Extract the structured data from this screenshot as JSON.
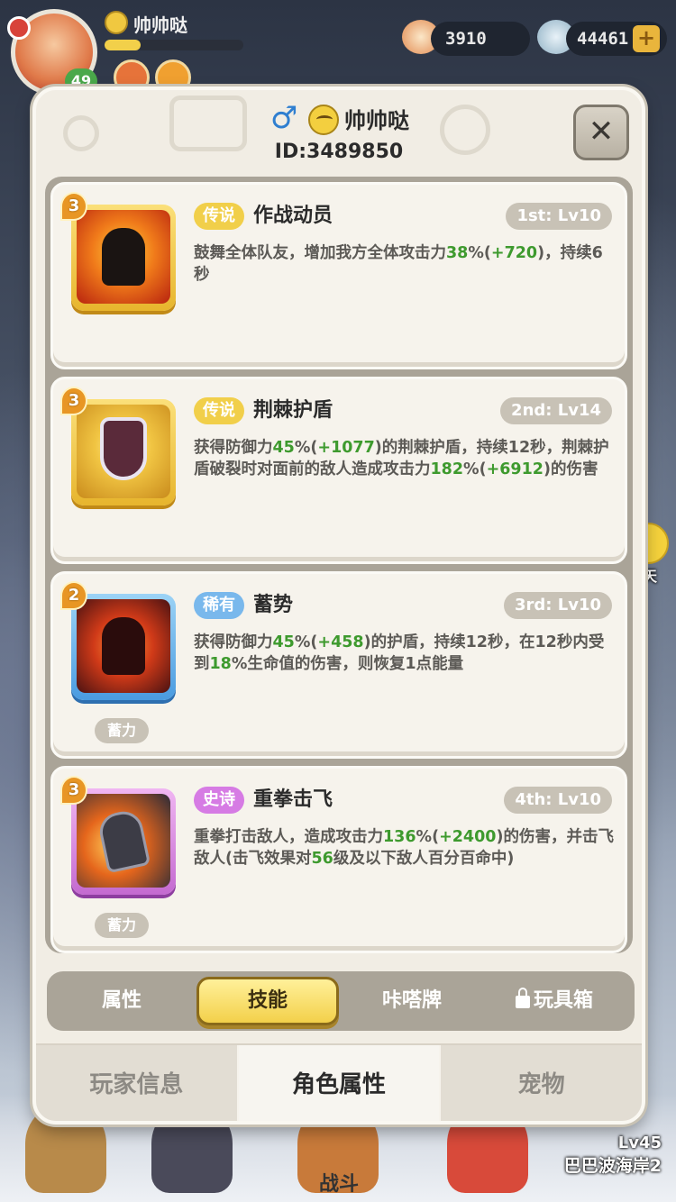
{
  "hud": {
    "player_name": "帅帅哒",
    "avatar_level": "49",
    "shells": "3910",
    "gems": "44461",
    "plus": "+"
  },
  "background": {
    "battle_label": "战斗",
    "lock_level": "Lv45",
    "area_name": "巴巴波海岸2",
    "chat_label": "聊天"
  },
  "modal": {
    "gender_symbol": "♂",
    "player_name": "帅帅哒",
    "player_id": "ID:3489850",
    "close_label": "✕"
  },
  "skills": [
    {
      "stars": "3",
      "rarity": "传说",
      "name": "作战动员",
      "slot": "1st: Lv10",
      "desc_parts": [
        "鼓舞全体队友，增加我方全体攻击力",
        "38",
        "%(",
        "+720",
        ")，持续6秒"
      ],
      "charge": ""
    },
    {
      "stars": "3",
      "rarity": "传说",
      "name": "荆棘护盾",
      "slot": "2nd: Lv14",
      "desc_parts": [
        "获得防御力",
        "45",
        "%(",
        "+1077",
        ")的荆棘护盾，持续12秒，荆棘护盾破裂时对面前的敌人造成攻击力",
        "182",
        "%(",
        "+6912",
        ")的伤害"
      ],
      "charge": ""
    },
    {
      "stars": "2",
      "rarity": "稀有",
      "name": "蓄势",
      "slot": "3rd: Lv10",
      "desc_parts": [
        "获得防御力",
        "45",
        "%(",
        "+458",
        ")的护盾，持续12秒，在12秒内受到",
        "18",
        "%生命值的伤害，则恢复1点能量"
      ],
      "charge": "蓄力"
    },
    {
      "stars": "3",
      "rarity": "史诗",
      "name": "重拳击飞",
      "slot": "4th: Lv10",
      "desc_parts": [
        "重拳打击敌人，造成攻击力",
        "136",
        "%(",
        "+2400",
        ")的伤害，并击飞敌人(击飞效果对",
        "56",
        "级及以下敌人百分百命中)"
      ],
      "charge": "蓄力"
    }
  ],
  "sub_tabs": [
    {
      "label": "属性"
    },
    {
      "label": "技能"
    },
    {
      "label": "咔嗒牌"
    },
    {
      "label": "玩具箱"
    }
  ],
  "main_tabs": [
    {
      "label": "玩家信息"
    },
    {
      "label": "角色属性"
    },
    {
      "label": "宠物"
    }
  ],
  "colors": {
    "accent_number": "#3e9a2e",
    "legend_badge": "#f1cf4a",
    "rare_badge": "#79b8ec",
    "epic_badge": "#d67be4",
    "active_tab": "#f3d04a"
  }
}
